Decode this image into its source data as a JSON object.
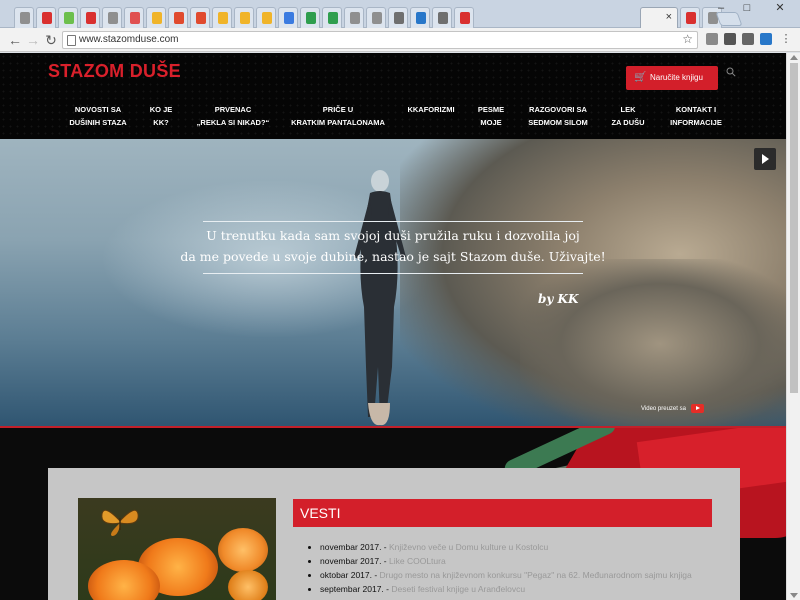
{
  "browser": {
    "address_bar": {
      "url": "www.stazomduse.com"
    },
    "tab_count_pinned": 28,
    "tab_favicon_colors": [
      "#8f8f8f",
      "#d9302f",
      "#6cbf4d",
      "#d9302f",
      "#8f8f8f",
      "#e05050",
      "#f0b429",
      "#e04a2e",
      "#e04a2e",
      "#f0b429",
      "#f0b429",
      "#f0b429",
      "#3b7be0",
      "#2f9e4e",
      "#2f9e4e",
      "#8f8f8f",
      "#8f8f8f",
      "#6f6f6f",
      "#2877c9",
      "#6f6f6f",
      "#d9302f"
    ],
    "active_tab": {
      "close_symbol": "×"
    }
  },
  "site": {
    "logo": "STAZOM DUŠE",
    "order_button": "Naručite knjigu",
    "menu": [
      {
        "label": "NOVOSTI SA\nDUŠINIH STAZA"
      },
      {
        "label": "KO JE\nKK?"
      },
      {
        "label": "PRVENAC\n„REKLA SI NIKAD?“"
      },
      {
        "label": "PRIČE U\nKRATKIM PANTALONAMA"
      },
      {
        "label": "KKAFORIZMI"
      },
      {
        "label": "PESME\nMOJE"
      },
      {
        "label": "RAZGOVORI SA\nSEDMOM SILOM"
      },
      {
        "label": "LEK\nZA DUŠU"
      },
      {
        "label": "KONTAKT I\nINFORMACIJE"
      }
    ],
    "hero": {
      "quote_line1": "U trenutku kada sam svojoj duši pružila ruku i dozvolila joj",
      "quote_line2": "da me povede u svoje dubine, nastao je sajt Stazom duše. Uživajte!",
      "signature": "by KK",
      "video_credit": "Video preuzet sa"
    },
    "news": {
      "header": "VESTI",
      "items": [
        {
          "date": "novembar 2017.",
          "text": "Književno veče u Domu kulture u Kostolcu"
        },
        {
          "date": "novembar 2017.",
          "text": "Like COOLtura"
        },
        {
          "date": "oktobar 2017.",
          "text": "Drugo mesto na književnom konkursu \"Pegaz\" na 62. Međunarodnom sajmu knjiga"
        },
        {
          "date": "septembar 2017.",
          "text": "Deseti festival knjige u Aranđelovcu"
        }
      ]
    },
    "colors": {
      "brand_red": "#d31f2a",
      "header_bg": "#050505"
    }
  }
}
